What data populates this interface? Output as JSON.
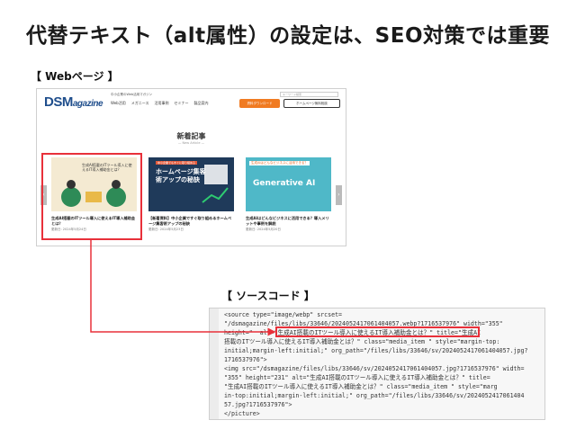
{
  "title": "代替テキスト（alt属性）の設定は、SEO対策では重要",
  "labels": {
    "web": "【 Webページ 】",
    "source": "【 ソースコード 】"
  },
  "webpage": {
    "logo_main": "DSM",
    "logo_sub": "agazine",
    "tagline": "中小企業のWeb活用マガジン",
    "nav": [
      "Web活用",
      "メガニース",
      "活用事例",
      "セミナー",
      "製品案内"
    ],
    "search_placeholder": "キーワード検索",
    "btn_orange": "資料ダウンロード",
    "btn_outline": "ホームページ無料相談",
    "section_title": "新着記事",
    "section_sub": "— New Article —",
    "cards": [
      {
        "img_text": "生成AI搭載のITツール導入に使えるIT導入補助金とは？",
        "title": "生成AI搭載のITツール導入に使えるIT導入補助金とは？",
        "date": "更新日: 2024年5月24日"
      },
      {
        "img_top": "中小企業でもすぐに取り組める",
        "img_text": "ホームページ集客術アップの秘訣",
        "title": "【新着資料】中小企業ですぐ取り組めるホームページ集客術アップの秘訣",
        "date": "更新日: 2024年5月23日"
      },
      {
        "img_top": "生成AIはどんなビジネスに活用できる？",
        "img_text": "Generative AI",
        "title": "生成AIはどんなビジネスに活用できる？導入メリットや事例を解説",
        "date": "更新日: 2024年5月20日"
      }
    ]
  },
  "source": {
    "lines": [
      "<source type=\"image/webp\" srcset=",
      "\"/dsmagazine/files/libs/33646/2024052417061404057.webp?1716537976\" width=\"355\"",
      "height=\"  alt=\"生成AI搭載のITツール導入に使えるIT導入補助金とは？\" title=\"生成AI",
      "搭載のITツール導入に使えるIT導入補助金とは？\" class=\"media_item \" style=\"margin-top:",
      "initial;margin-left:initial;\" org_path=\"/files/libs/33646/sv/2024052417061404057.jpg?",
      "1716537976\">",
      "<img src=\"/dsmagazine/files/libs/33646/sv/2024052417061404057.jpg?1716537976\" width=",
      "\"355\" height=\"231\" alt=\"生成AI搭載のITツール導入に使えるIT導入補助金とは？\" title=",
      "\"生成AI搭載のITツール導入に使えるIT導入補助金とは？\" class=\"media_item \" style=\"marg",
      "in-top:initial;margin-left:initial;\" org_path=\"/files/libs/33646/sv/2024052417061404",
      "57.jpg?1716537976\">",
      "</picture>"
    ]
  }
}
